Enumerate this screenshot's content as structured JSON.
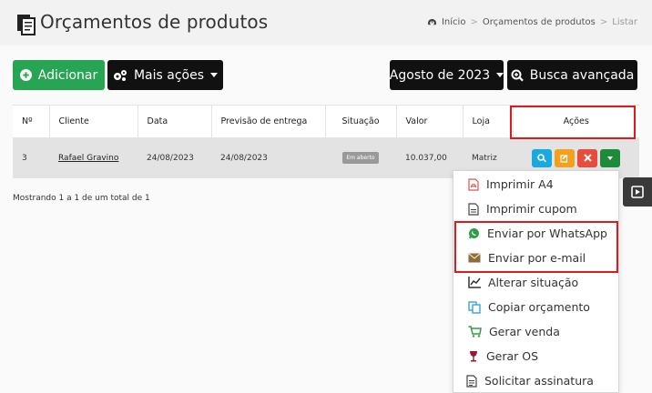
{
  "header": {
    "title": "Orçamentos de produtos",
    "breadcrumb": [
      "Início",
      "Orçamentos de produtos",
      "Listar"
    ]
  },
  "toolbar": {
    "add_label": "Adicionar",
    "more_label": "Mais ações",
    "month_label": "Agosto de 2023",
    "search_label": "Busca avançada"
  },
  "table": {
    "columns": [
      "Nº",
      "Cliente",
      "Data",
      "Previsão de entrega",
      "Situação",
      "Valor",
      "Loja",
      "Ações"
    ],
    "rows": [
      {
        "numero": "3",
        "cliente": "Rafael Gravino",
        "data": "24/08/2023",
        "previsao": "24/08/2023",
        "situacao": "Em aberto",
        "valor": "10.037,00",
        "loja": "Matriz"
      }
    ],
    "footer": "Mostrando 1 a 1 de um total de 1"
  },
  "dropdown": {
    "items": [
      {
        "label": "Imprimir A4",
        "icon": "pdf-icon"
      },
      {
        "label": "Imprimir cupom",
        "icon": "file-icon"
      },
      {
        "label": "Enviar por WhatsApp",
        "icon": "whatsapp-icon"
      },
      {
        "label": "Enviar por e-mail",
        "icon": "envelope-icon"
      },
      {
        "label": "Alterar situação",
        "icon": "line-chart-icon"
      },
      {
        "label": "Copiar orçamento",
        "icon": "copy-icon"
      },
      {
        "label": "Gerar venda",
        "icon": "cart-icon"
      },
      {
        "label": "Gerar OS",
        "icon": "wine-icon"
      },
      {
        "label": "Solicitar assinatura",
        "icon": "file-text-icon"
      }
    ]
  },
  "colors": {
    "add": "#27a454",
    "dark": "#111111",
    "highlight": "#e0191f",
    "view": "#19a9de",
    "edit": "#f3a01d",
    "delete": "#e74c3c",
    "dropdown_toggle": "#1e8a3c"
  }
}
